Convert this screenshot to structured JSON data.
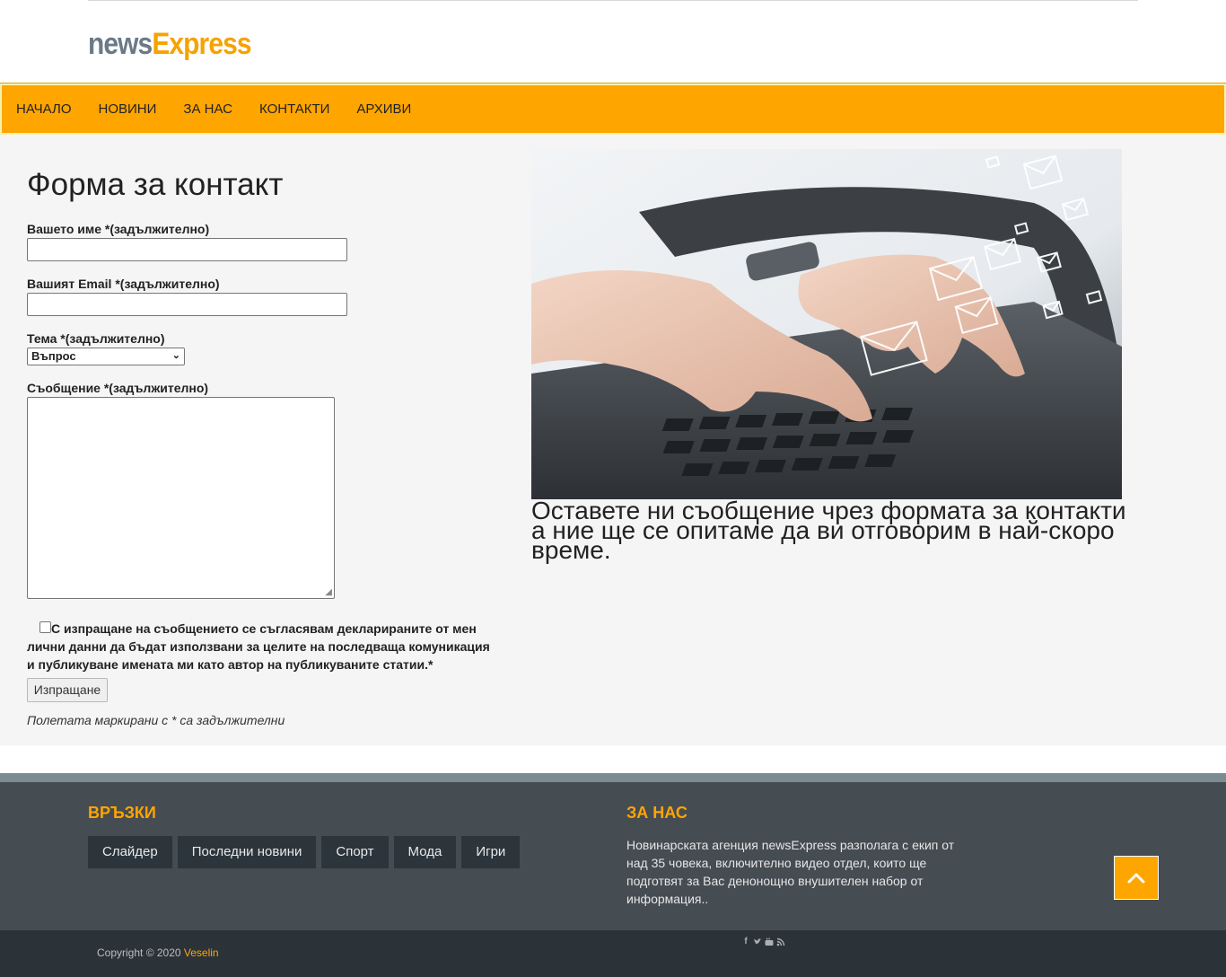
{
  "header": {
    "logo_part1": "news",
    "logo_part2": "Express"
  },
  "nav": {
    "items": [
      "НАЧАЛО",
      "НОВИНИ",
      "ЗА НАС",
      "КОНТАКТИ",
      "АРХИВИ"
    ]
  },
  "form": {
    "title": "Форма за контакт",
    "name_label": "Вашето име *(задължително)",
    "name_value": "",
    "email_label": "Вашият Email *(задължително)",
    "email_value": "",
    "subject_label": "Тема *(задължително)",
    "subject_selected": "Въпрос",
    "message_label": "Съобщение *(задължително)",
    "message_value": "",
    "consent_text": "С изпращане на съобщението се съгласявам декларираните от мен лични данни да бъдат използвани за целите на последваща комуникация и публикуване имената ми като автор на публикуваните статии.*",
    "consent_checked": false,
    "submit_label": "Изпращане",
    "required_note": "Полетата маркирани с * са задължителни"
  },
  "aside": {
    "blurb": "Оставете ни съобщение чрез формата за контакти а ние ще се опитаме да ви отговорим в най-скоро време."
  },
  "footer": {
    "links_title": "ВРЪЗКИ",
    "links": [
      "Слайдер",
      "Последни новини",
      "Спорт",
      "Мода",
      "Игри"
    ],
    "about_title": "ЗА НАС",
    "about_text": "Новинарската агенция newsExpress разполага с екип от над 35 човека, включително видео отдел, които ще подготвят за Вас денонощно внушителен набор от информация..",
    "copyright_prefix": "Copyright © 2020",
    "copyright_author": "Veselin",
    "social_icons": [
      "facebook-icon",
      "twitter-icon",
      "youtube-icon",
      "rss-icon"
    ]
  },
  "colors": {
    "accent": "#ffa500",
    "footer_bg": "#454c52",
    "bottom_bg": "#2c3338",
    "tag_bg": "#2c353c"
  }
}
